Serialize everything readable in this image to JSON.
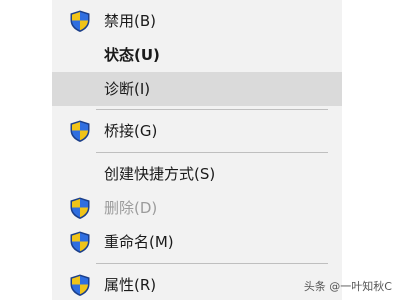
{
  "context_menu": {
    "items": [
      {
        "label": "禁用(B)",
        "icon": "uac-shield-icon"
      },
      {
        "label": "状态(U)"
      },
      {
        "label": "诊断(I)"
      },
      {
        "label": "桥接(G)",
        "icon": "uac-shield-icon"
      },
      {
        "label": "创建快捷方式(S)"
      },
      {
        "label": "删除(D)",
        "icon": "uac-shield-icon"
      },
      {
        "label": "重命名(M)",
        "icon": "uac-shield-icon"
      },
      {
        "label": "属性(R)",
        "icon": "uac-shield-icon"
      }
    ]
  },
  "watermark": {
    "text": "头条 @一叶知秋C"
  }
}
